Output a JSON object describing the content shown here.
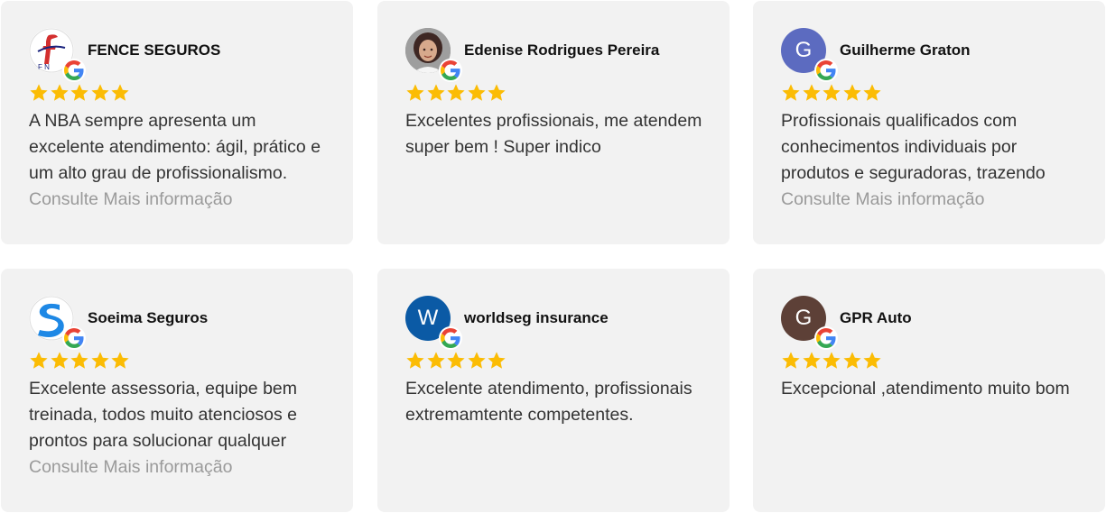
{
  "colors": {
    "star": "#fbbc04",
    "card_bg": "#f2f2f2",
    "more_link": "#9a9a9a"
  },
  "reviews": [
    {
      "name": "FENCE SEGUROS",
      "rating": 5,
      "avatar": {
        "type": "logo",
        "icon": "fence-logo-icon"
      },
      "text": "A NBA sempre apresenta um excelente atendimento: ágil, prático e um alto grau de profissionalismo.",
      "more": "Consulte Mais informação"
    },
    {
      "name": "Edenise Rodrigues Pereira",
      "rating": 5,
      "avatar": {
        "type": "photo",
        "icon": "user-photo-icon"
      },
      "text": "Excelentes profissionais, me atendem super bem ! Super indico"
    },
    {
      "name": "Guilherme Graton",
      "rating": 5,
      "avatar": {
        "type": "letter",
        "letter": "G",
        "color": "#5c6bc0"
      },
      "text": "Profissionais qualificados com conhecimentos individuais por produtos e seguradoras, trazendo",
      "more": "Consulte Mais informação"
    },
    {
      "name": "Soeima Seguros",
      "rating": 5,
      "avatar": {
        "type": "logo",
        "icon": "soeima-logo-icon"
      },
      "text": "Excelente assessoria, equipe bem treinada, todos muito atenciosos e prontos para solucionar qualquer",
      "more": "Consulte Mais informação"
    },
    {
      "name": "worldseg insurance",
      "rating": 5,
      "avatar": {
        "type": "letter",
        "letter": "W",
        "color": "#0b5aa5"
      },
      "text": "Excelente atendimento, profissionais extremamtente competentes."
    },
    {
      "name": "GPR Auto",
      "rating": 5,
      "avatar": {
        "type": "letter",
        "letter": "G",
        "color": "#5d4037"
      },
      "text": "Excepcional ,atendimento muito bom"
    }
  ]
}
